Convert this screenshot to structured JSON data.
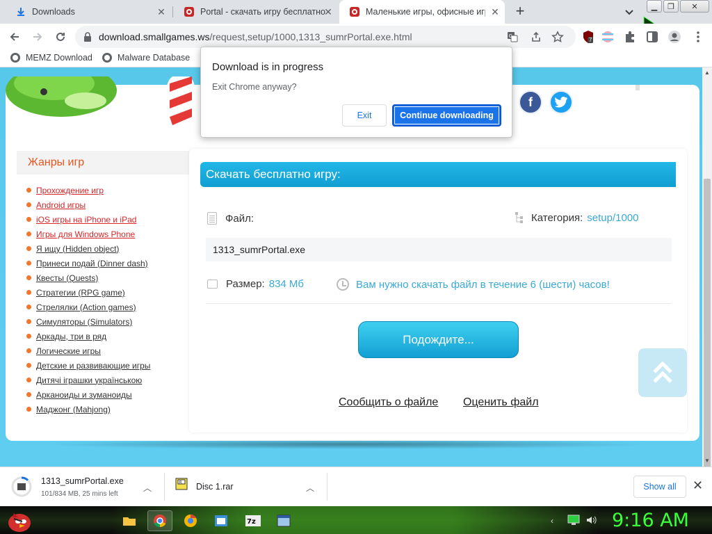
{
  "browser": {
    "tabs": [
      {
        "title": "Downloads",
        "active": false
      },
      {
        "title": "Portal - скачать игру бесплатно",
        "active": false
      },
      {
        "title": "Маленькие игры, офисные игр",
        "active": true
      }
    ],
    "url_host": "download.smallgames.ws",
    "url_path": "/request,setup/1000,1313_sumrPortal.exe.html",
    "extension_badge": "7",
    "bookmarks": [
      {
        "label": "MEMZ Download"
      },
      {
        "label": "Malware Database"
      }
    ]
  },
  "dialog": {
    "title": "Download is in progress",
    "message": "Exit Chrome anyway?",
    "exit_label": "Exit",
    "continue_label": "Continue downloading"
  },
  "sidebar": {
    "title": "Жанры игр",
    "genres": [
      {
        "label": "Прохождение игр",
        "red": true
      },
      {
        "label": "Android игры",
        "red": true
      },
      {
        "label": "iOS игры на iPhone и iPad",
        "red": true
      },
      {
        "label": "Игры для Windows Phone",
        "red": true
      },
      {
        "label": "Я ищу (Hidden object)",
        "red": false
      },
      {
        "label": "Принеси подай (Dinner dash)",
        "red": false
      },
      {
        "label": "Квесты (Quests)",
        "red": false
      },
      {
        "label": "Стратегии (RPG game)",
        "red": false
      },
      {
        "label": "Стрелялки (Action games)",
        "red": false
      },
      {
        "label": "Симуляторы (Simulators)",
        "red": false
      },
      {
        "label": "Аркады, три в ряд",
        "red": false
      },
      {
        "label": "Логические игры",
        "red": false
      },
      {
        "label": "Детские и развивающие игры",
        "red": false
      },
      {
        "label": "Дитячі іграшки українською",
        "red": false
      },
      {
        "label": "Арканоиды и зуманоиды",
        "red": false
      },
      {
        "label": "Маджонг (Mahjong)",
        "red": false
      }
    ]
  },
  "panel": {
    "header": "Скачать бесплатно игру:",
    "file_label": "Файл:",
    "category_label": "Категория:",
    "category_value": "setup/1000",
    "filename": "1313_sumrPortal.exe",
    "size_label": "Размер:",
    "size_value": "834 Мб",
    "time_notice": "Вам нужно скачать файл в течение 6 (шести) часов!",
    "wait_button": "Подождите...",
    "report_link": "Сообщить о файле",
    "rate_link": "Оценить файл"
  },
  "shelf": {
    "items": [
      {
        "name": "1313_sumrPortal.exe",
        "status": "101/834 MB, 25 mins left"
      },
      {
        "name": "Disc 1.rar",
        "status": ""
      }
    ],
    "show_all": "Show all"
  },
  "taskbar": {
    "time": "9:16 AM"
  },
  "colors": {
    "accent": "#1a73e8",
    "page_bg": "#5fcdf0",
    "genre_title": "#e8551f",
    "link_blue": "#3aa9d5",
    "clock_green": "#3cff3c"
  }
}
